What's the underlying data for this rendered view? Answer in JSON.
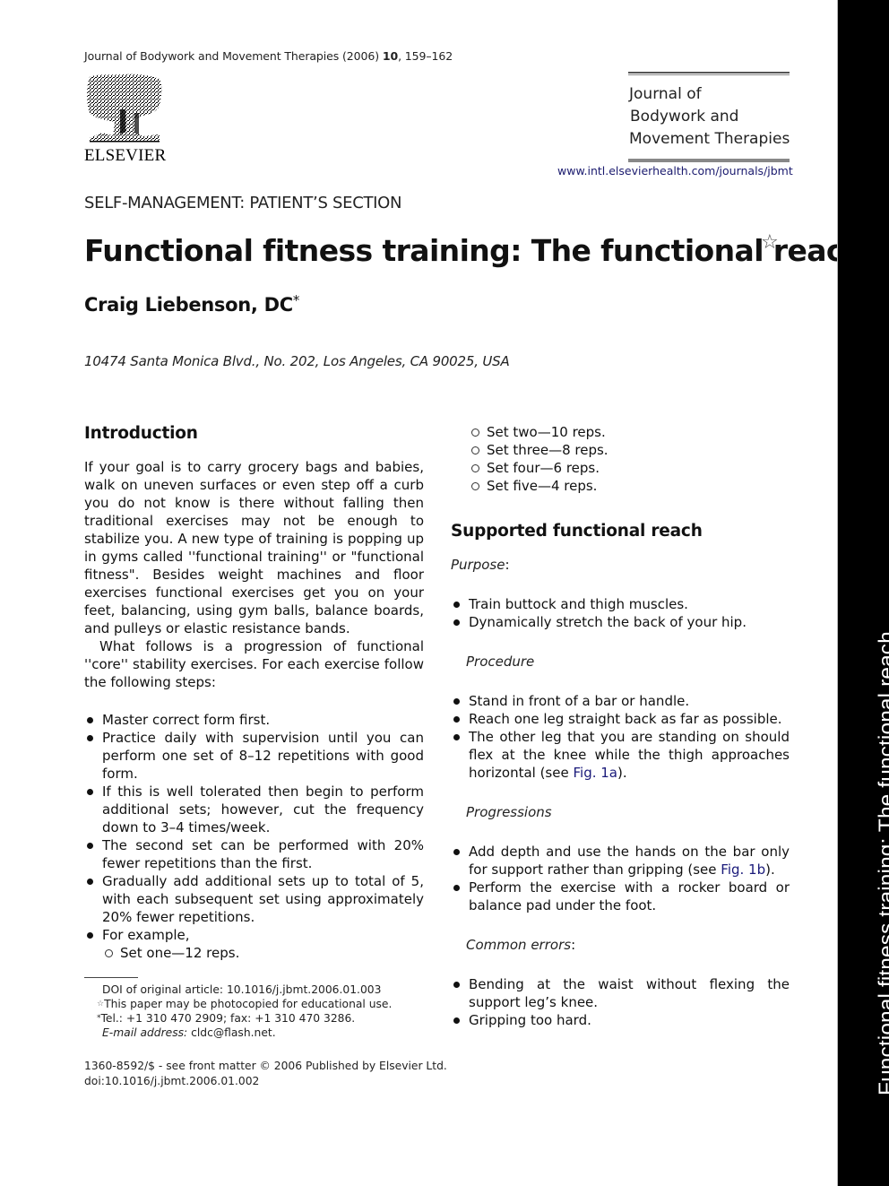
{
  "running_header": {
    "journal": "Journal of Bodywork and Movement Therapies (2006) ",
    "volume": "10",
    "pages": ", 159–162"
  },
  "publisher": {
    "logo_icon": "elsevier-tree-logo",
    "name": "ELSEVIER"
  },
  "journal_box": {
    "line1": "Journal of",
    "line2": "Bodywork and",
    "line3": "Movement Therapies",
    "url": "www.intl.elsevierhealth.com/journals/jbmt"
  },
  "article": {
    "section": "SELF-MANAGEMENT: PATIENT’S SECTION",
    "title": "Functional fitness training: The functional reach",
    "title_note_symbol": "☆",
    "author": "Craig Liebenson, DC",
    "author_note_symbol": "*",
    "address": "10474 Santa Monica Blvd., No. 202, Los Angeles, CA 90025, USA"
  },
  "left_column": {
    "intro_heading": "Introduction",
    "intro_para1": "If your goal is to carry grocery bags and babies, walk on uneven surfaces or even step off a curb you do not know is there without falling then traditional exercises may not be enough to stabilize you. A new type of training is popping up in gyms called ''functional training'' or \"functional fitness\". Besides weight machines and floor exercises functional exercises get you on your feet, balancing, using gym balls, balance boards, and pulleys or elastic resistance bands.",
    "intro_para2": "What follows is a progression of functional ''core'' stability exercises. For each exercise follow the following steps:",
    "steps": [
      "Master correct form first.",
      "Practice daily with supervision until you can perform one set of 8–12 repetitions with good form.",
      "If this is well tolerated then begin to perform additional sets; however, cut the frequency down to 3–4 times/week.",
      "The second set can be performed with 20% fewer repetitions than the first.",
      "Gradually add additional sets up to total of 5, with each subsequent set using approximately 20% fewer repetitions.",
      "For example,"
    ],
    "example_sets": [
      "Set one—12 reps.",
      "Set two—10 reps.",
      "Set three—8 reps.",
      "Set four—6 reps.",
      "Set five—4 reps."
    ]
  },
  "footnotes": {
    "doi_original": "DOI of original article: 10.1016/j.jbmt.2006.01.003",
    "star_symbol": "☆",
    "star_note": "This paper may be photocopied for educational use.",
    "asterisk_symbol": "*",
    "contact": "Tel.: +1 310 470 2909; fax: +1 310 470 3286.",
    "email_label": "E-mail address:",
    "email": " cldc@flash.net.",
    "front_matter": "1360-8592/$ - see front matter © 2006 Published by Elsevier Ltd.",
    "doi": "doi:10.1016/j.jbmt.2006.01.002"
  },
  "right_column": {
    "heading": "Supported functional reach",
    "purpose_label": "Purpose",
    "purpose_colon": ":",
    "purpose_items": [
      "Train buttock and thigh muscles.",
      "Dynamically stretch the back of your hip."
    ],
    "procedure_label": "Procedure",
    "procedure_items": [
      "Stand in front of a bar or handle.",
      "Reach one leg straight back as far as possible."
    ],
    "procedure_item3_text": "The other leg that you are standing on should flex at the knee while the thigh approaches horizontal (see ",
    "procedure_item3_link": "Fig. 1a",
    "procedure_item3_end": ").",
    "progressions_label": "Progressions",
    "progression1_text": "Add depth and use the hands on the bar only for support rather than gripping (see ",
    "progression1_link": "Fig. 1b",
    "progression1_end": ").",
    "progression2_text": "Perform the exercise with a rocker board or balance pad under the foot.",
    "errors_label": "Common errors",
    "errors_colon": ":",
    "error_items": [
      "Bending at the waist without flexing the support leg’s knee.",
      "Gripping too hard."
    ]
  },
  "sidebar": {
    "text": "Functional fitness training: The functional reach"
  },
  "colors": {
    "link": "#1a1a7a",
    "sidebar_bg": "#000000",
    "sidebar_text": "#ffffff"
  }
}
